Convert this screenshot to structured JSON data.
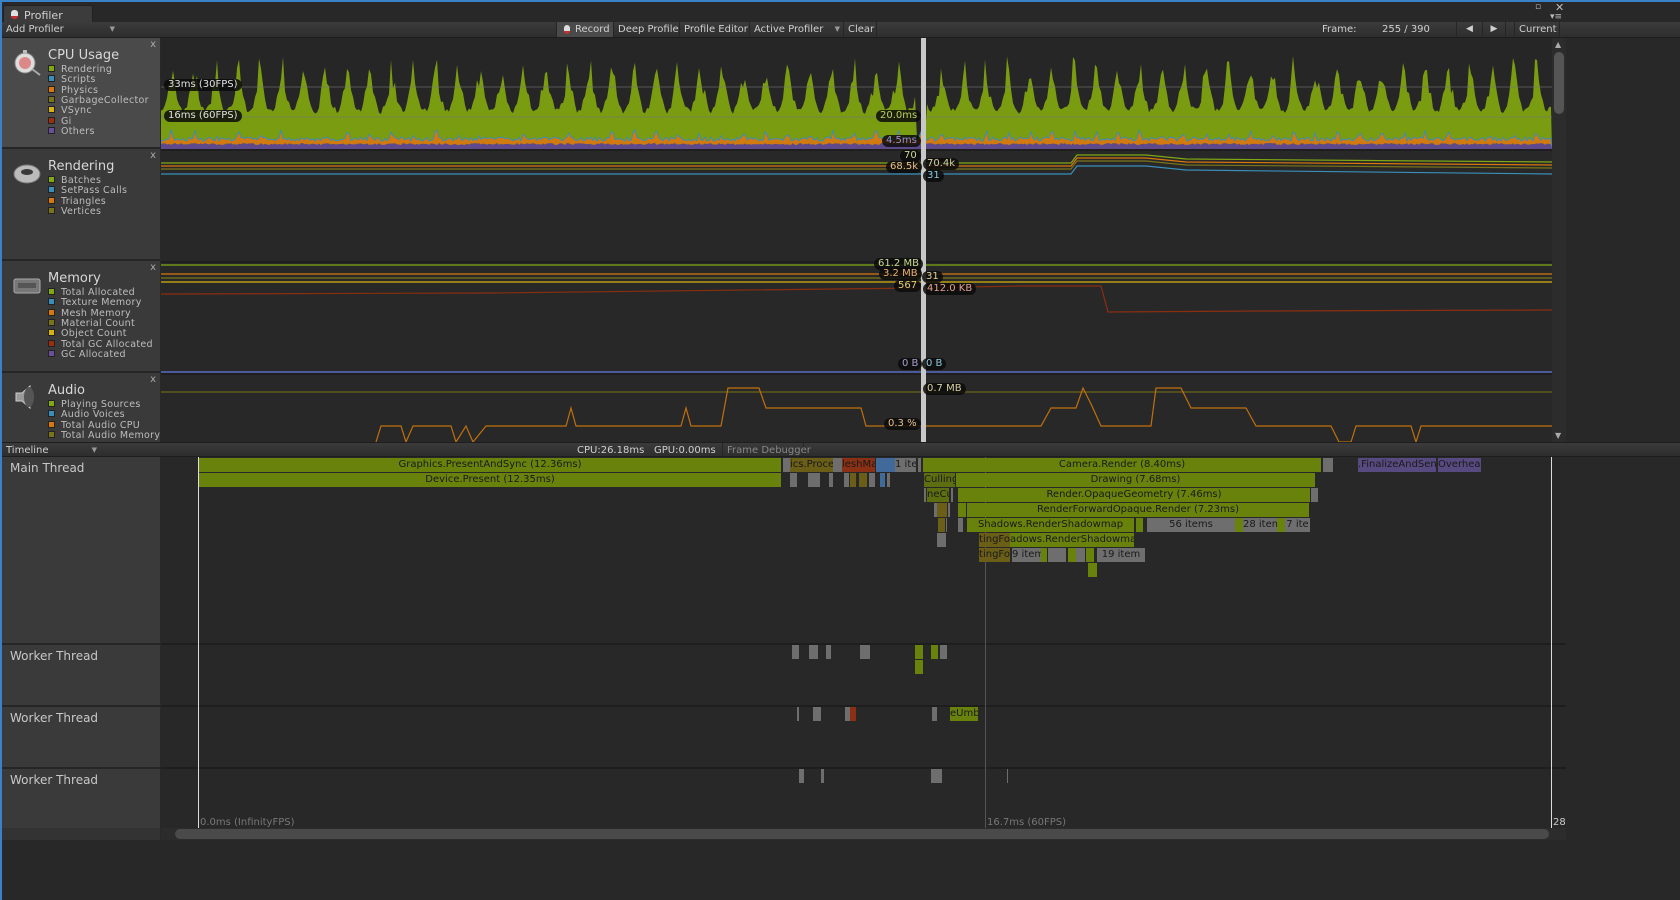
{
  "window": {
    "tab_title": "Profiler",
    "maximize_icon": "maximize-icon",
    "close_icon": "close-icon",
    "menu_icon": "window-menu-icon"
  },
  "toolbar": {
    "add_profiler": "Add Profiler",
    "record": "Record",
    "deep_profile": "Deep Profile",
    "profile_editor": "Profile Editor",
    "active_profiler": "Active Profiler",
    "clear": "Clear",
    "frame_label": "Frame:",
    "frame_value": "255 / 390",
    "prev_icon": "◀",
    "next_icon": "▶",
    "current": "Current"
  },
  "modules": [
    {
      "title": "CPU Usage",
      "close": "x",
      "legend": [
        {
          "label": "Rendering",
          "color": "#7fa813"
        },
        {
          "label": "Scripts",
          "color": "#3a8fb8"
        },
        {
          "label": "Physics",
          "color": "#d8780c"
        },
        {
          "label": "GarbageCollector",
          "color": "#7a7318"
        },
        {
          "label": "VSync",
          "color": "#d8b20c"
        },
        {
          "label": "Gi",
          "color": "#9a2e10"
        },
        {
          "label": "Others",
          "color": "#6a4e9a"
        }
      ]
    },
    {
      "title": "Rendering",
      "close": "x",
      "legend": [
        {
          "label": "Batches",
          "color": "#7fa813"
        },
        {
          "label": "SetPass Calls",
          "color": "#3a8fb8"
        },
        {
          "label": "Triangles",
          "color": "#d8780c"
        },
        {
          "label": "Vertices",
          "color": "#7a7318"
        }
      ]
    },
    {
      "title": "Memory",
      "close": "x",
      "legend": [
        {
          "label": "Total Allocated",
          "color": "#7fa813"
        },
        {
          "label": "Texture Memory",
          "color": "#3a8fb8"
        },
        {
          "label": "Mesh Memory",
          "color": "#d8780c"
        },
        {
          "label": "Material Count",
          "color": "#7a7318"
        },
        {
          "label": "Object Count",
          "color": "#d8b20c"
        },
        {
          "label": "Total GC Allocated",
          "color": "#9a2e10"
        },
        {
          "label": "GC Allocated",
          "color": "#6a4e9a"
        }
      ]
    },
    {
      "title": "Audio",
      "close": "x",
      "legend": [
        {
          "label": "Playing Sources",
          "color": "#7fa813"
        },
        {
          "label": "Audio Voices",
          "color": "#3a8fb8"
        },
        {
          "label": "Total Audio CPU",
          "color": "#d8780c"
        },
        {
          "label": "Total Audio Memory",
          "color": "#7a7318"
        }
      ]
    }
  ],
  "cpu_chart": {
    "line_30fps": "33ms (30FPS)",
    "line_60fps": "16ms (60FPS)",
    "rendering_value": "20.0ms",
    "others_value": "4.5ms"
  },
  "rendering_chart": {
    "batches": "70",
    "triangles": "68.5k",
    "vertices": "70.4k",
    "setpass": "31"
  },
  "memory_chart": {
    "total_allocated": "61.2 MB",
    "mesh_memory": "3.2 MB",
    "material_count": "31",
    "object_count": "567",
    "total_gc": "412.0 KB",
    "gc_allocated": "0 B",
    "texture_memory": "0 B"
  },
  "audio_chart": {
    "total_audio_memory": "0.7 MB",
    "total_audio_cpu": "0.3 %"
  },
  "timeline_bar": {
    "view_mode": "Timeline",
    "cpu": "CPU:26.18ms",
    "gpu": "GPU:0.00ms",
    "frame_debugger": "Frame Debugger"
  },
  "threads": [
    "Main Thread",
    "Worker Thread",
    "Worker Thread",
    "Worker Thread"
  ],
  "samples": {
    "present_and_sync": "Graphics.PresentAndSync (12.36ms)",
    "device_present": "Device.Present (12.35ms)",
    "physics_proc": "ics.Proce",
    "mesh_ma": "leshMa",
    "items_a": "1 ite",
    "camera_render": "Camera.Render (8.40ms)",
    "finalize": ".FinalizeAndSen",
    "overhead": "Overhead",
    "culling": "Culling",
    "ne_cu": "neCu",
    "drawing": "Drawing (7.68ms)",
    "opaque_geometry": "Render.OpaqueGeometry (7.46ms)",
    "forward_opaque": "RenderForwardOpaque.Render (7.23ms)",
    "shadowmap": "Shadows.RenderShadowmap",
    "items_56": "56 items",
    "items_28": "28 item",
    "items_7": "7 ite",
    "ting_fo": "tingFo",
    "shadowmap2": "adows.RenderShadowmap",
    "ting_fo2": "tingFo",
    "items_9": "9 item",
    "items_19": "19 item",
    "e_umb": "eUmb"
  },
  "time_axis": {
    "start": "0.0ms (InfinityFPS)",
    "mid": "16.7ms (60FPS)",
    "end": "28"
  },
  "colors": {
    "selection": "#c8c8c8",
    "accent": "#3a82c8",
    "sample_green": "#68820c",
    "sample_grey": "#6e6e6e",
    "sample_olive": "#6b5e17",
    "sample_red": "#8a3015",
    "sample_blue": "#3f6a9a",
    "sample_purple": "#574a80"
  }
}
